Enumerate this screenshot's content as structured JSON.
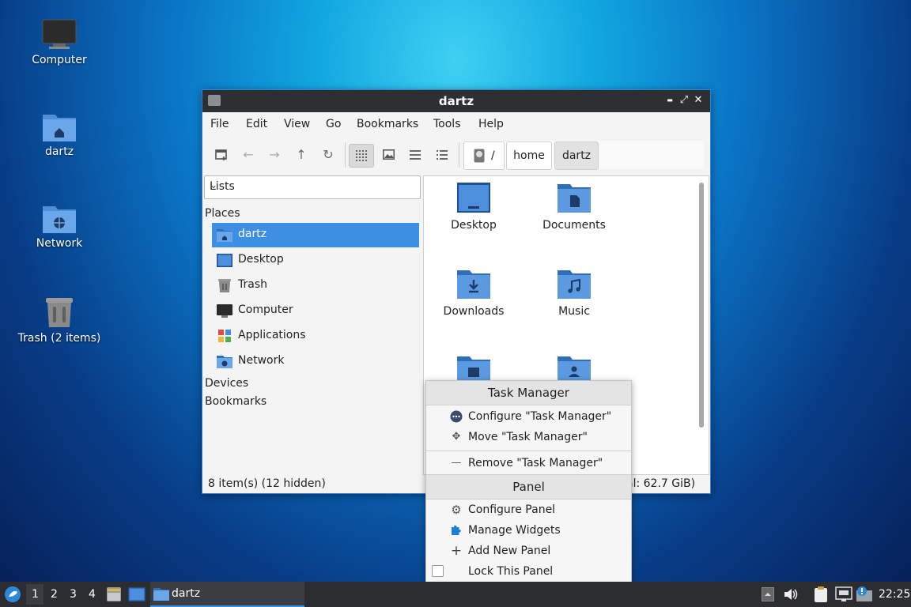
{
  "desktop": {
    "icons": [
      {
        "label": "Computer"
      },
      {
        "label": "dartz"
      },
      {
        "label": "Network"
      },
      {
        "label": "Trash (2 items)"
      }
    ]
  },
  "window": {
    "title": "dartz",
    "controls": {
      "minimize": "▬",
      "maximize": "⤢",
      "close": "✕"
    },
    "menu": [
      "File",
      "Edit",
      "View",
      "Go",
      "Bookmarks",
      "Tools",
      "Help"
    ],
    "breadcrumb": [
      "/",
      "home",
      "dartz"
    ],
    "sidebar": {
      "view_mode": "Lists",
      "places_label": "Places",
      "places": [
        "dartz",
        "Desktop",
        "Trash",
        "Computer",
        "Applications",
        "Network"
      ],
      "devices_label": "Devices",
      "bookmarks_label": "Bookmarks"
    },
    "files": [
      "Desktop",
      "Documents",
      "Downloads",
      "Music",
      "",
      ""
    ],
    "status_left": "8 item(s) (12 hidden)",
    "status_right": "al: 62.7 GiB)"
  },
  "context_menu": {
    "header1": "Task Manager",
    "configure": "Configure \"Task Manager\"",
    "move": "Move \"Task Manager\"",
    "remove": "Remove \"Task Manager\"",
    "header2": "Panel",
    "configure_panel": "Configure Panel",
    "manage_widgets": "Manage Widgets",
    "add_panel": "Add New Panel",
    "lock_panel": "Lock This Panel"
  },
  "taskbar": {
    "workspaces": [
      "1",
      "2",
      "3",
      "4"
    ],
    "task": "dartz",
    "clock": "22:25"
  },
  "colors": {
    "accent": "#3d8fe3",
    "folder": "#5b9ae0",
    "titlebar": "#2d2f33"
  }
}
